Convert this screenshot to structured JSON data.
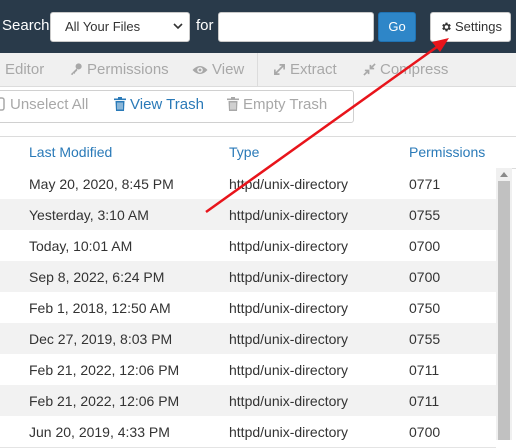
{
  "search": {
    "label": "Search",
    "scope_selected": "All Your Files",
    "for_label": "for",
    "query_value": "",
    "go_label": "Go"
  },
  "settings": {
    "label": "Settings"
  },
  "toolbar": {
    "editor": "Editor",
    "permissions": "Permissions",
    "view": "View",
    "extract": "Extract",
    "compress": "Compress"
  },
  "actions": {
    "unselect_all": "Unselect All",
    "view_trash": "View Trash",
    "empty_trash": "Empty Trash"
  },
  "table": {
    "headers": {
      "last_modified": "Last Modified",
      "type": "Type",
      "permissions": "Permissions"
    },
    "rows": [
      {
        "modified": "May 20, 2020, 8:45 PM",
        "type": "httpd/unix-directory",
        "perms": "0771"
      },
      {
        "modified": "Yesterday, 3:10 AM",
        "type": "httpd/unix-directory",
        "perms": "0755"
      },
      {
        "modified": "Today, 10:01 AM",
        "type": "httpd/unix-directory",
        "perms": "0700"
      },
      {
        "modified": "Sep 8, 2022, 6:24 PM",
        "type": "httpd/unix-directory",
        "perms": "0700"
      },
      {
        "modified": "Feb 1, 2018, 12:50 AM",
        "type": "httpd/unix-directory",
        "perms": "0750"
      },
      {
        "modified": "Dec 27, 2019, 8:03 PM",
        "type": "httpd/unix-directory",
        "perms": "0755"
      },
      {
        "modified": "Feb 21, 2022, 12:06 PM",
        "type": "httpd/unix-directory",
        "perms": "0711"
      },
      {
        "modified": "Feb 21, 2022, 12:06 PM",
        "type": "httpd/unix-directory",
        "perms": "0711"
      },
      {
        "modified": "Jun 20, 2019, 4:33 PM",
        "type": "httpd/unix-directory",
        "perms": "0700"
      }
    ]
  },
  "colors": {
    "header_bar": "#293a4a",
    "accent_link": "#2a7ab8",
    "go_button": "#2e86c8",
    "annotation_arrow": "#e8141b"
  },
  "icons": {
    "settings": "gear-icon",
    "editor": "pencil-icon",
    "permissions": "key-icon",
    "view": "eye-icon",
    "extract": "expand-icon",
    "compress": "compress-icon",
    "unselect_all": "checkbox-icon",
    "view_trash": "trash-icon",
    "empty_trash": "trash-icon",
    "scope_select": "chevron-down-icon"
  }
}
